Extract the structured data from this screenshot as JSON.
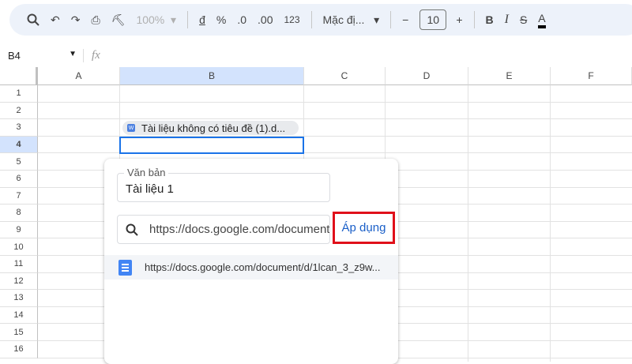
{
  "toolbar": {
    "zoom": "100%",
    "currency": "đ",
    "percent": "%",
    "dec_decrease": ".0",
    "dec_increase": ".00",
    "number_format": "123",
    "font": "Mặc đị...",
    "font_size": "10",
    "bold": "B",
    "italic": "I",
    "text_color": "A",
    "text_color_value": "#000000"
  },
  "formula_bar": {
    "cell_ref": "B4",
    "fx": "fx"
  },
  "columns": [
    "A",
    "B",
    "C",
    "D",
    "E",
    "F"
  ],
  "rows": [
    "1",
    "2",
    "3",
    "4",
    "5",
    "6",
    "7",
    "8",
    "9",
    "10",
    "11",
    "12",
    "13",
    "14",
    "15",
    "16"
  ],
  "cells": {
    "B3_chip": "Tài liệu không có tiêu đề (1).d..."
  },
  "popup": {
    "text_label": "Văn bản",
    "text_value": "Tài liệu 1",
    "link_value": "https://docs.google.com/document/",
    "apply_label": "Áp dụng",
    "suggestion": "https://docs.google.com/document/d/1lcan_3_z9w..."
  },
  "colors": {
    "accent": "#1a73e8",
    "highlight_box": "#e0101a",
    "header_selected": "#d3e3fd"
  }
}
